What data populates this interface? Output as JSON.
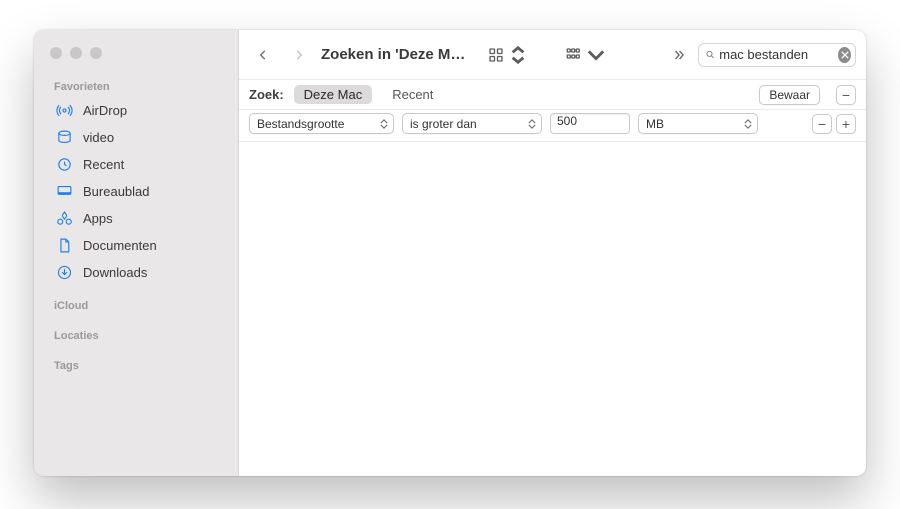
{
  "colors": {
    "traffic_red": "#ff5f57",
    "traffic_yellow": "#febc2e",
    "traffic_green": "#28c840",
    "traffic_dim": "#c9c7c8",
    "icon_blue": "#1f7df1"
  },
  "sidebar": {
    "sections": {
      "favorites": {
        "label": "Favorieten"
      },
      "icloud": {
        "label": "iCloud"
      },
      "locations": {
        "label": "Locaties"
      },
      "tags": {
        "label": "Tags"
      }
    },
    "items": [
      {
        "id": "airdrop",
        "label": "AirDrop"
      },
      {
        "id": "video",
        "label": "video"
      },
      {
        "id": "recent",
        "label": "Recent"
      },
      {
        "id": "desktop",
        "label": "Bureaublad"
      },
      {
        "id": "apps",
        "label": "Apps"
      },
      {
        "id": "documents",
        "label": "Documenten"
      },
      {
        "id": "downloads",
        "label": "Downloads"
      }
    ]
  },
  "toolbar": {
    "title": "Zoeken in 'Deze M…",
    "search_value": "mac bestanden"
  },
  "scope": {
    "label": "Zoek:",
    "this_mac": "Deze Mac",
    "recent": "Recent",
    "save": "Bewaar"
  },
  "criteria": {
    "attribute": "Bestandsgrootte",
    "operator": "is groter dan",
    "value": "500",
    "unit": "MB"
  }
}
